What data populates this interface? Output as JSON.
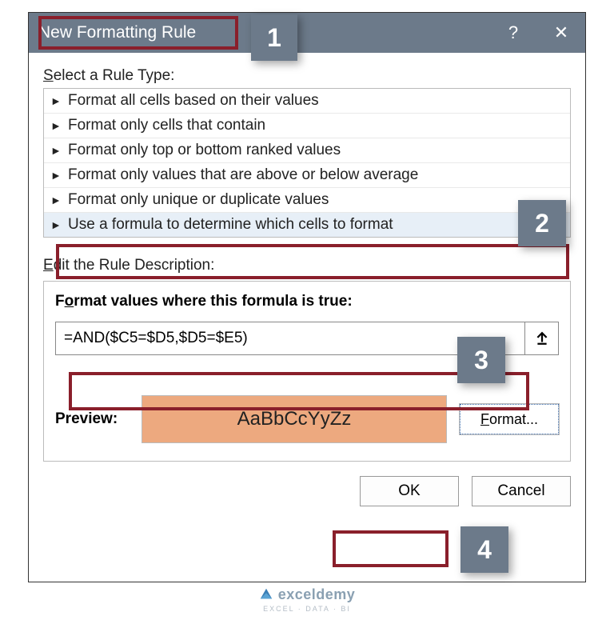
{
  "dialog": {
    "title": "New Formatting Rule",
    "help_label": "?",
    "close_label": "✕"
  },
  "callouts": {
    "1": "1",
    "2": "2",
    "3": "3",
    "4": "4"
  },
  "rule_type_label": "elect a Rule Type:",
  "rule_type_underline": "S",
  "rule_types": [
    "Format all cells based on their values",
    "Format only cells that contain",
    "Format only top or bottom ranked values",
    "Format only values that are above or below average",
    "Format only unique or duplicate values",
    "Use a formula to determine which cells to format"
  ],
  "edit_label": "dit the Rule Description:",
  "edit_underline": "E",
  "formula_label_pre": "F",
  "formula_label_u": "o",
  "formula_label_post": "rmat values where this formula is true:",
  "formula_value": "=AND($C5=$D5,$D5=$E5)",
  "preview_label": "Preview:",
  "preview_sample": "AaBbCcYyZz",
  "format_btn_u": "F",
  "format_btn_rest": "ormat...",
  "ok_label": "OK",
  "cancel_label": "Cancel",
  "watermark": {
    "brand": "exceldemy",
    "sub": "EXCEL · DATA · BI"
  }
}
